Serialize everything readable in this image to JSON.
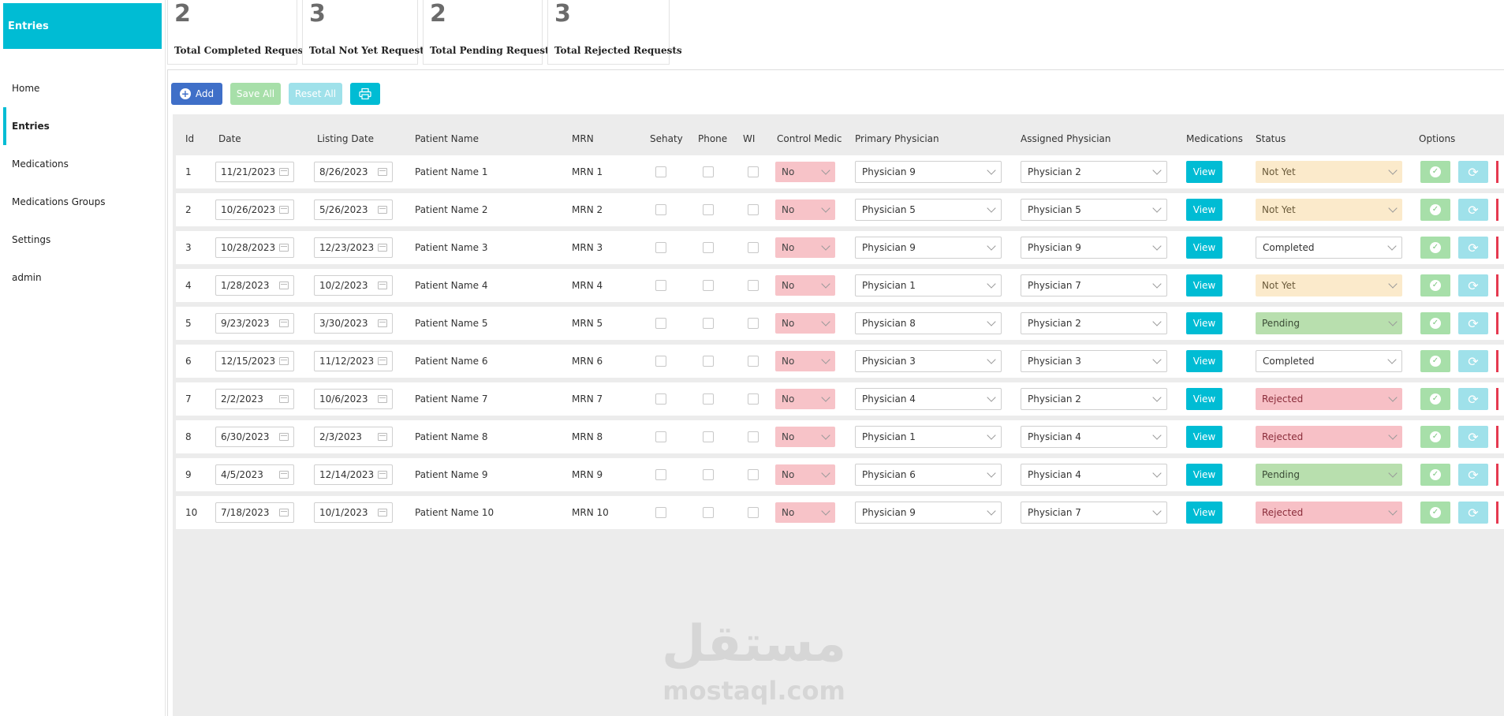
{
  "sidebar": {
    "brand": "Entries",
    "items": [
      {
        "label": "Home"
      },
      {
        "label": "Entries"
      },
      {
        "label": "Medications"
      },
      {
        "label": "Medications Groups"
      },
      {
        "label": "Settings"
      },
      {
        "label": "admin"
      }
    ]
  },
  "stats": [
    {
      "value": "2",
      "label": "Total Completed Requests"
    },
    {
      "value": "3",
      "label": "Total Not Yet Requests"
    },
    {
      "value": "2",
      "label": "Total Pending Requests"
    },
    {
      "value": "3",
      "label": "Total Rejected Requests"
    }
  ],
  "toolbar": {
    "add_label": "Add",
    "save_all_label": "Save All",
    "reset_all_label": "Reset All",
    "print_icon": "printer-icon"
  },
  "table": {
    "headers": [
      "Id",
      "Date",
      "Listing Date",
      "Patient Name",
      "MRN",
      "Sehaty",
      "Phone",
      "WI",
      "Control Medic",
      "Primary Physician",
      "Assigned Physician",
      "Medications",
      "Status",
      "Options"
    ],
    "view_label": "View",
    "rows": [
      {
        "id": "1",
        "date": "11/21/2023",
        "listing": "8/26/2023",
        "name": "Patient Name 1",
        "mrn": "MRN 1",
        "control": "No",
        "primary": "Physician 9",
        "assigned": "Physician 2",
        "status": "Not Yet"
      },
      {
        "id": "2",
        "date": "10/26/2023",
        "listing": "5/26/2023",
        "name": "Patient Name 2",
        "mrn": "MRN 2",
        "control": "No",
        "primary": "Physician 5",
        "assigned": "Physician 5",
        "status": "Not Yet"
      },
      {
        "id": "3",
        "date": "10/28/2023",
        "listing": "12/23/2023",
        "name": "Patient Name 3",
        "mrn": "MRN 3",
        "control": "No",
        "primary": "Physician 9",
        "assigned": "Physician 9",
        "status": "Completed"
      },
      {
        "id": "4",
        "date": "1/28/2023",
        "listing": "10/2/2023",
        "name": "Patient Name 4",
        "mrn": "MRN 4",
        "control": "No",
        "primary": "Physician 1",
        "assigned": "Physician 7",
        "status": "Not Yet"
      },
      {
        "id": "5",
        "date": "9/23/2023",
        "listing": "3/30/2023",
        "name": "Patient Name 5",
        "mrn": "MRN 5",
        "control": "No",
        "primary": "Physician 8",
        "assigned": "Physician 2",
        "status": "Pending"
      },
      {
        "id": "6",
        "date": "12/15/2023",
        "listing": "11/12/2023",
        "name": "Patient Name 6",
        "mrn": "MRN 6",
        "control": "No",
        "primary": "Physician 3",
        "assigned": "Physician 3",
        "status": "Completed"
      },
      {
        "id": "7",
        "date": "2/2/2023",
        "listing": "10/6/2023",
        "name": "Patient Name 7",
        "mrn": "MRN 7",
        "control": "No",
        "primary": "Physician 4",
        "assigned": "Physician 2",
        "status": "Rejected"
      },
      {
        "id": "8",
        "date": "6/30/2023",
        "listing": "2/3/2023",
        "name": "Patient Name 8",
        "mrn": "MRN 8",
        "control": "No",
        "primary": "Physician 1",
        "assigned": "Physician 4",
        "status": "Rejected"
      },
      {
        "id": "9",
        "date": "4/5/2023",
        "listing": "12/14/2023",
        "name": "Patient Name 9",
        "mrn": "MRN 9",
        "control": "No",
        "primary": "Physician 6",
        "assigned": "Physician 4",
        "status": "Pending"
      },
      {
        "id": "10",
        "date": "7/18/2023",
        "listing": "10/1/2023",
        "name": "Patient Name 10",
        "mrn": "MRN 10",
        "control": "No",
        "primary": "Physician 9",
        "assigned": "Physician 7",
        "status": "Rejected"
      }
    ]
  },
  "status_colors": {
    "Not Yet": "#fbeacb",
    "Completed": "#ffffff",
    "Pending": "#b8dfae",
    "Rejected": "#f7c0c6"
  },
  "accent_color": "#00bcd4",
  "watermark": {
    "arabic": "مستقل",
    "latin": "mostaql.com"
  }
}
